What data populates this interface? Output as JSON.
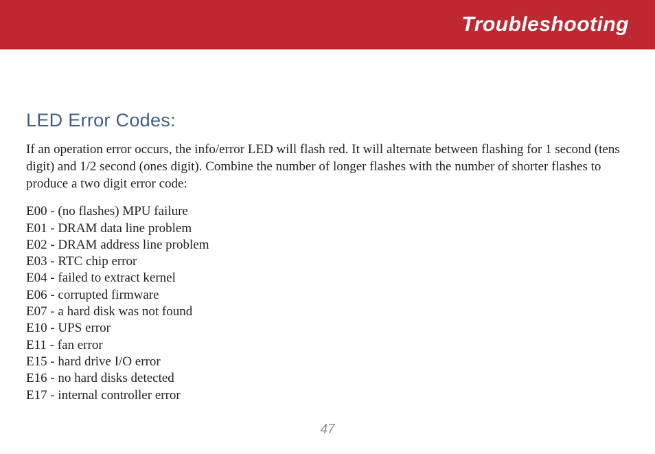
{
  "header": {
    "title": "Troubleshooting"
  },
  "section": {
    "heading": "LED Error Codes:",
    "intro": "If an operation error occurs, the info/error LED will flash red.  It will alternate between flashing for 1 second (tens digit) and 1/2 second (ones digit).  Combine the number of longer flashes with the number of shorter flashes to produce a two digit error code:"
  },
  "error_codes": [
    "E00 - (no flashes) MPU failure",
    "E01 - DRAM data line problem",
    "E02 - DRAM address line problem",
    "E03 - RTC chip error",
    "E04 - failed to extract kernel",
    "E06 - corrupted firmware",
    "E07 - a hard disk was not found",
    "E10 - UPS error",
    "E11 - fan error",
    "E15 - hard drive I/O error",
    "E16 - no hard disks detected",
    "E17 - internal controller error"
  ],
  "page_number": "47"
}
